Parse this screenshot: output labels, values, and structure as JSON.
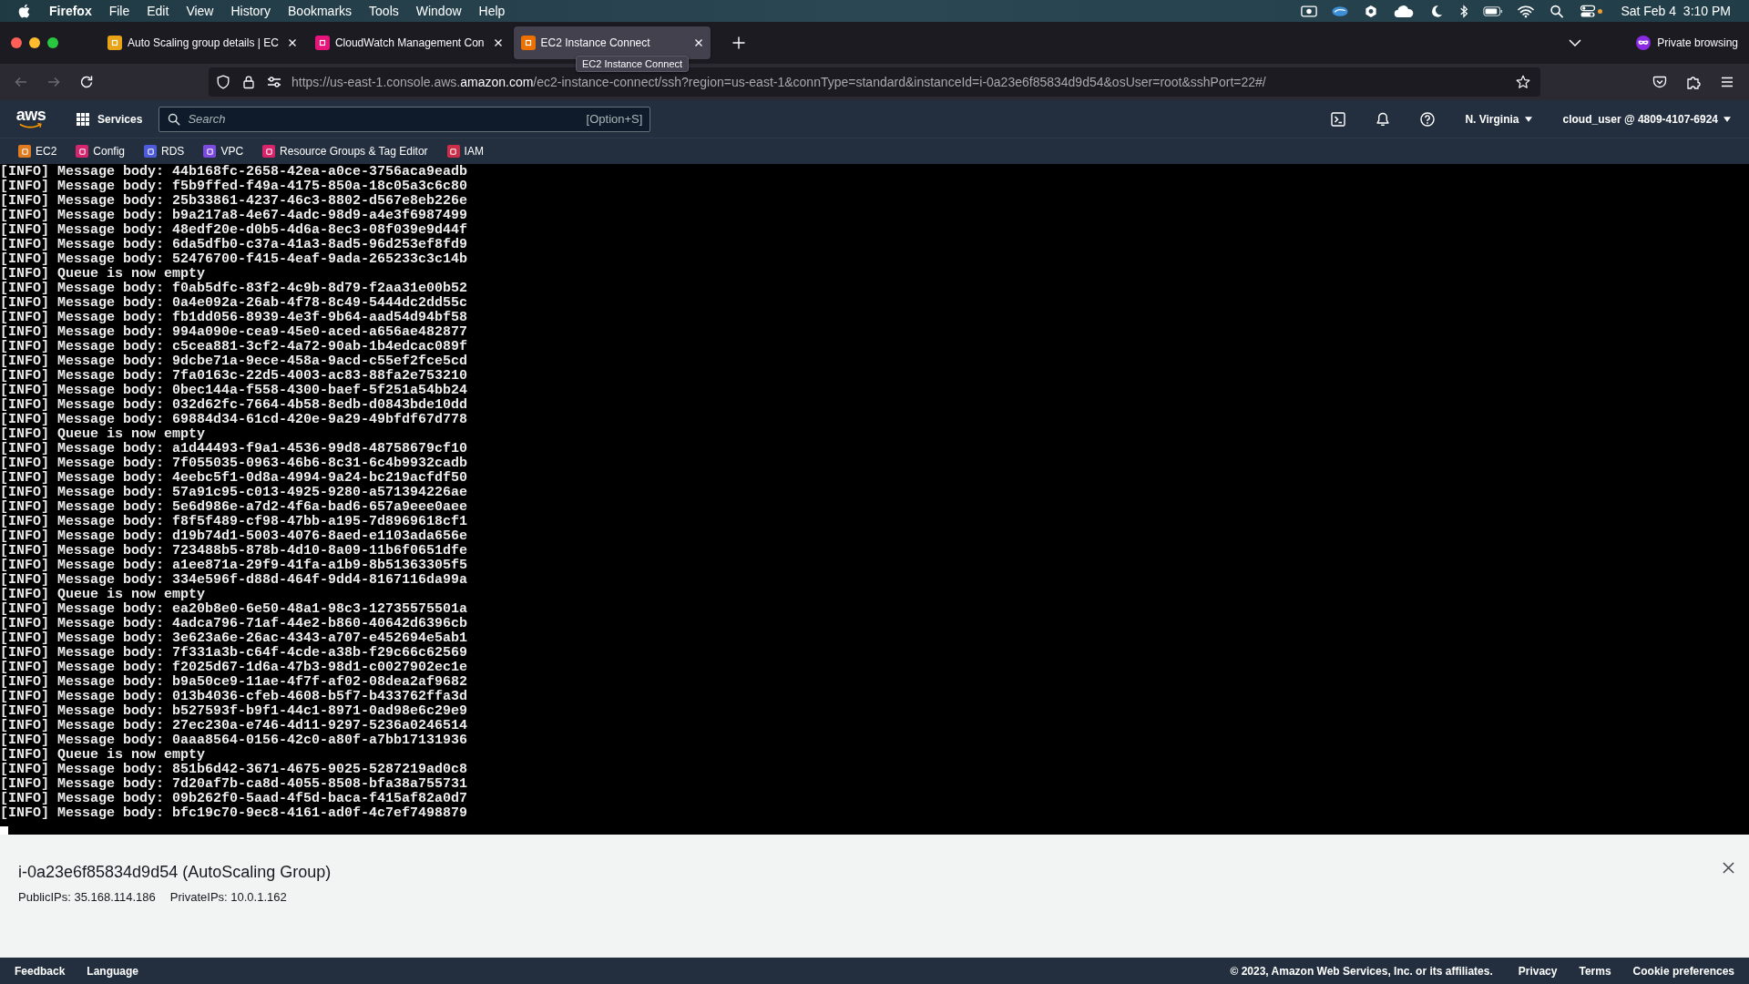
{
  "menu_bar": {
    "app_name": "Firefox",
    "menus": [
      "File",
      "Edit",
      "View",
      "History",
      "Bookmarks",
      "Tools",
      "Window",
      "Help"
    ],
    "clock": "Sat Feb 4  3:10 PM"
  },
  "tabs": [
    {
      "title": "Auto Scaling group details | EC",
      "selected": false,
      "color": "#e8a317"
    },
    {
      "title": "CloudWatch Management Con",
      "selected": false,
      "color": "#e7157b"
    },
    {
      "title": "EC2 Instance Connect",
      "selected": true,
      "color": "#ed7100"
    }
  ],
  "tab_tooltip": "EC2 Instance Connect",
  "private_browsing": "Private browsing",
  "navigation": {
    "back_disabled": true,
    "forward_disabled": true
  },
  "address_bar": {
    "url_prefix": "https://us-east-1.console.aws.",
    "url_domain": "amazon.com",
    "url_path": "/ec2-instance-connect/ssh?region=us-east-1&connType=standard&instanceId=i-0a23e6f85834d9d54&osUser=root&sshPort=22#/"
  },
  "console_nav": {
    "logo": "aws",
    "services": "Services",
    "search": {
      "placeholder": "Search",
      "shortcut": "[Option+S]"
    },
    "region": "N. Virginia",
    "account": "cloud_user @ 4809-4107-6924"
  },
  "favorites": [
    {
      "label": "EC2",
      "color": "#e07b1f"
    },
    {
      "label": "Config",
      "color": "#d6246e"
    },
    {
      "label": "RDS",
      "color": "#4d5bd9"
    },
    {
      "label": "VPC",
      "color": "#7d4ae0"
    },
    {
      "label": "Resource Groups & Tag Editor",
      "color": "#d8246b"
    },
    {
      "label": "IAM",
      "color": "#cc2e47"
    }
  ],
  "terminal": {
    "lines": [
      "[INFO] Message body: 44b168fc-2658-42ea-a0ce-3756aca9eadb",
      "[INFO] Message body: f5b9ffed-f49a-4175-850a-18c05a3c6c80",
      "[INFO] Message body: 25b33861-4237-46c3-8802-d567e8eb226e",
      "[INFO] Message body: b9a217a8-4e67-4adc-98d9-a4e3f6987499",
      "[INFO] Message body: 48edf20e-d0b5-4d6a-8ec3-08f039e9d44f",
      "[INFO] Message body: 6da5dfb0-c37a-41a3-8ad5-96d253ef8fd9",
      "[INFO] Message body: 52476700-f415-4eaf-9ada-265233c3c14b",
      "[INFO] Queue is now empty",
      "[INFO] Message body: f0ab5dfc-83f2-4c9b-8d79-f2aa31e00b52",
      "[INFO] Message body: 0a4e092a-26ab-4f78-8c49-5444dc2dd55c",
      "[INFO] Message body: fb1dd056-8939-4e3f-9b64-aad54d94bf58",
      "[INFO] Message body: 994a090e-cea9-45e0-aced-a656ae482877",
      "[INFO] Message body: c5cea881-3cf2-4a72-90ab-1b4edcac089f",
      "[INFO] Message body: 9dcbe71a-9ece-458a-9acd-c55ef2fce5cd",
      "[INFO] Message body: 7fa0163c-22d5-4003-ac83-88fa2e753210",
      "[INFO] Message body: 0bec144a-f558-4300-baef-5f251a54bb24",
      "[INFO] Message body: 032d62fc-7664-4b58-8edb-d0843bde10dd",
      "[INFO] Message body: 69884d34-61cd-420e-9a29-49bfdf67d778",
      "[INFO] Queue is now empty",
      "[INFO] Message body: a1d44493-f9a1-4536-99d8-48758679cf10",
      "[INFO] Message body: 7f055035-0963-46b6-8c31-6c4b9932cadb",
      "[INFO] Message body: 4eebc5f1-0d8a-4994-9a24-bc219acfdf50",
      "[INFO] Message body: 57a91c95-c013-4925-9280-a571394226ae",
      "[INFO] Message body: 5e6d986e-a7d2-4f6a-bad6-657a9eee0aee",
      "[INFO] Message body: f8f5f489-cf98-47bb-a195-7d8969618cf1",
      "[INFO] Message body: d19b74d1-5003-4076-8aed-e1103ada656e",
      "[INFO] Message body: 723488b5-878b-4d10-8a09-11b6f0651dfe",
      "[INFO] Message body: a1ee871a-29f9-41fa-a1b9-8b51363305f5",
      "[INFO] Message body: 334e596f-d88d-464f-9dd4-8167116da99a",
      "[INFO] Queue is now empty",
      "[INFO] Message body: ea20b8e0-6e50-48a1-98c3-12735575501a",
      "[INFO] Message body: 4adca796-71af-44e2-b860-40642d6396cb",
      "[INFO] Message body: 3e623a6e-26ac-4343-a707-e452694e5ab1",
      "[INFO] Message body: 7f331a3b-c64f-4cde-a38b-f29c66c62569",
      "[INFO] Message body: f2025d67-1d6a-47b3-98d1-c0027902ec1e",
      "[INFO] Message body: b9a50ce9-11ae-4f7f-af02-08dea2af9682",
      "[INFO] Message body: 013b4036-cfeb-4608-b5f7-b433762ffa3d",
      "[INFO] Message body: b527593f-b9f1-44c1-8971-0ad98e6c29e9",
      "[INFO] Message body: 27ec230a-e746-4d11-9297-5236a0246514",
      "[INFO] Message body: 0aaa8564-0156-42c0-a80f-a7bb17131936",
      "[INFO] Queue is now empty",
      "[INFO] Message body: 851b6d42-3671-4675-9025-5287219ad0c8",
      "[INFO] Message body: 7d20af7b-ca8d-4055-8508-bfa38a755731",
      "[INFO] Message body: 09b262f0-5aad-4f5d-baca-f415af82a0d7",
      "[INFO] Message body: bfc19c70-9ec8-4161-ad0f-4c7ef7498879"
    ]
  },
  "instance_panel": {
    "title": "i-0a23e6f85834d9d54 (AutoScaling Group)",
    "public_ips": "PublicIPs: 35.168.114.186",
    "private_ips": "PrivateIPs: 10.0.1.162"
  },
  "footer": {
    "left_links": [
      "Feedback",
      "Language"
    ],
    "copyright": "© 2023, Amazon Web Services, Inc. or its affiliates.",
    "right_links": [
      "Privacy",
      "Terms",
      "Cookie preferences"
    ]
  }
}
